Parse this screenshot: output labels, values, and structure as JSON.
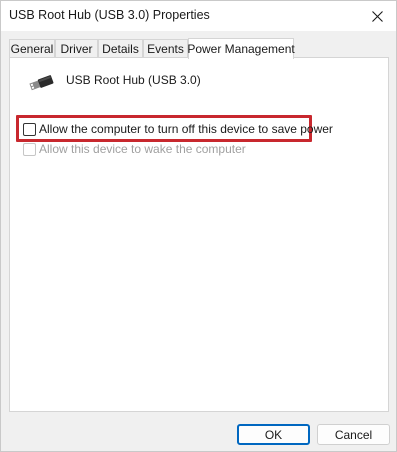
{
  "window": {
    "title": "USB Root Hub (USB 3.0) Properties",
    "close_icon": "close-icon"
  },
  "tabs": [
    {
      "label": "General",
      "active": false
    },
    {
      "label": "Driver",
      "active": false
    },
    {
      "label": "Details",
      "active": false
    },
    {
      "label": "Events",
      "active": false
    },
    {
      "label": "Power Management",
      "active": true
    }
  ],
  "panel": {
    "device_icon": "usb-plug-icon",
    "device_name": "USB Root Hub (USB 3.0)",
    "options": [
      {
        "label": "Allow the computer to turn off this device to save power",
        "checked": false,
        "enabled": true,
        "highlighted": true
      },
      {
        "label": "Allow this device to wake the computer",
        "checked": false,
        "enabled": false,
        "highlighted": false
      }
    ]
  },
  "buttons": {
    "ok": "OK",
    "cancel": "Cancel"
  },
  "colors": {
    "highlight": "#c8282e",
    "accent": "#0067c0"
  }
}
